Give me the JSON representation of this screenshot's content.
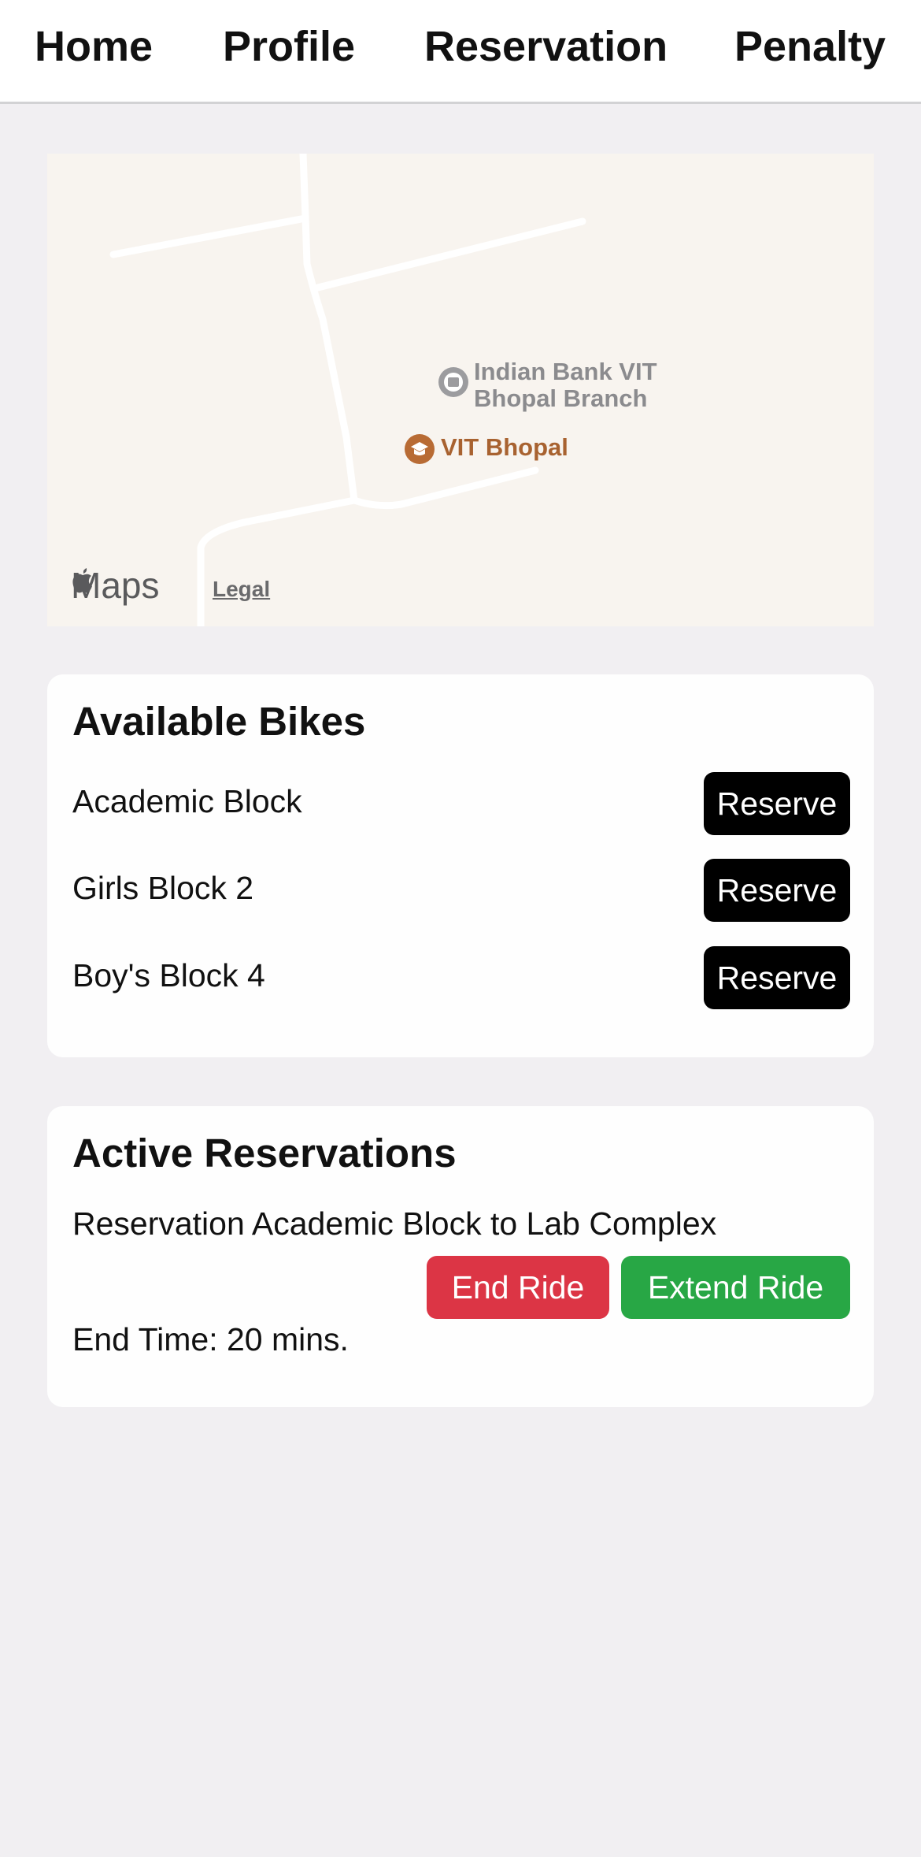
{
  "nav": {
    "items": [
      "Home",
      "Profile",
      "Reservation",
      "Penalty"
    ]
  },
  "map": {
    "poi_bank_line1": "Indian Bank VIT",
    "poi_bank_line2": "Bhopal Branch",
    "poi_campus": "VIT Bhopal",
    "maps_brand": "Maps",
    "legal_label": "Legal"
  },
  "available_bikes": {
    "title": "Available Bikes",
    "items": [
      {
        "location": "Academic Block",
        "action": "Reserve"
      },
      {
        "location": "Girls Block 2",
        "action": "Reserve"
      },
      {
        "location": "Boy's Block 4",
        "action": "Reserve"
      }
    ]
  },
  "active_reservations": {
    "title": "Active Reservations",
    "reservation_text": "Reservation Academic Block to Lab Complex",
    "end_ride_label": "End Ride",
    "extend_ride_label": "Extend Ride",
    "end_time_text": "End Time: 20 mins."
  },
  "colors": {
    "end_ride": "#dc3545",
    "extend_ride": "#28a745",
    "reserve": "#000000"
  }
}
